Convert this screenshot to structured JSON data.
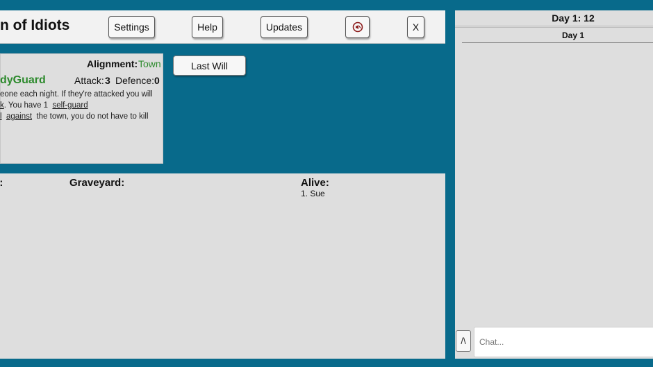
{
  "header": {
    "title": "n of Idiots",
    "settings_label": "Settings",
    "help_label": "Help",
    "updates_label": "Updates",
    "mute_icon": "speaker-muted-icon",
    "close_label": "X"
  },
  "role": {
    "alignment_label": "Alignment:",
    "alignment_value": "Town",
    "name": "dyGuard",
    "attack_label": "Attack:",
    "attack_value": "3",
    "defence_label": "Defence:",
    "defence_value": "0",
    "description": {
      "line1": "eone each night. If they're attacked you will",
      "line2_a": "k",
      "line2_b": ". You have 1",
      "line2_link": "self-guard",
      "line3_a": "l",
      "line3_link": "against",
      "line3_b": "the town, you do not have to kill"
    }
  },
  "last_will_label": "Last Will",
  "lists": {
    "roles_heading": "s:",
    "graveyard_heading": "Graveyard:",
    "alive_heading": "Alive:",
    "alive": [
      "1. Sue"
    ]
  },
  "chat": {
    "day_title": "Day 1: 12",
    "day_sub": "Day 1",
    "toggle_label": "/\\",
    "input_placeholder": "Chat..."
  },
  "colors": {
    "background": "#086a8b",
    "panel": "#dedede",
    "town_green": "#2e8b2e"
  }
}
